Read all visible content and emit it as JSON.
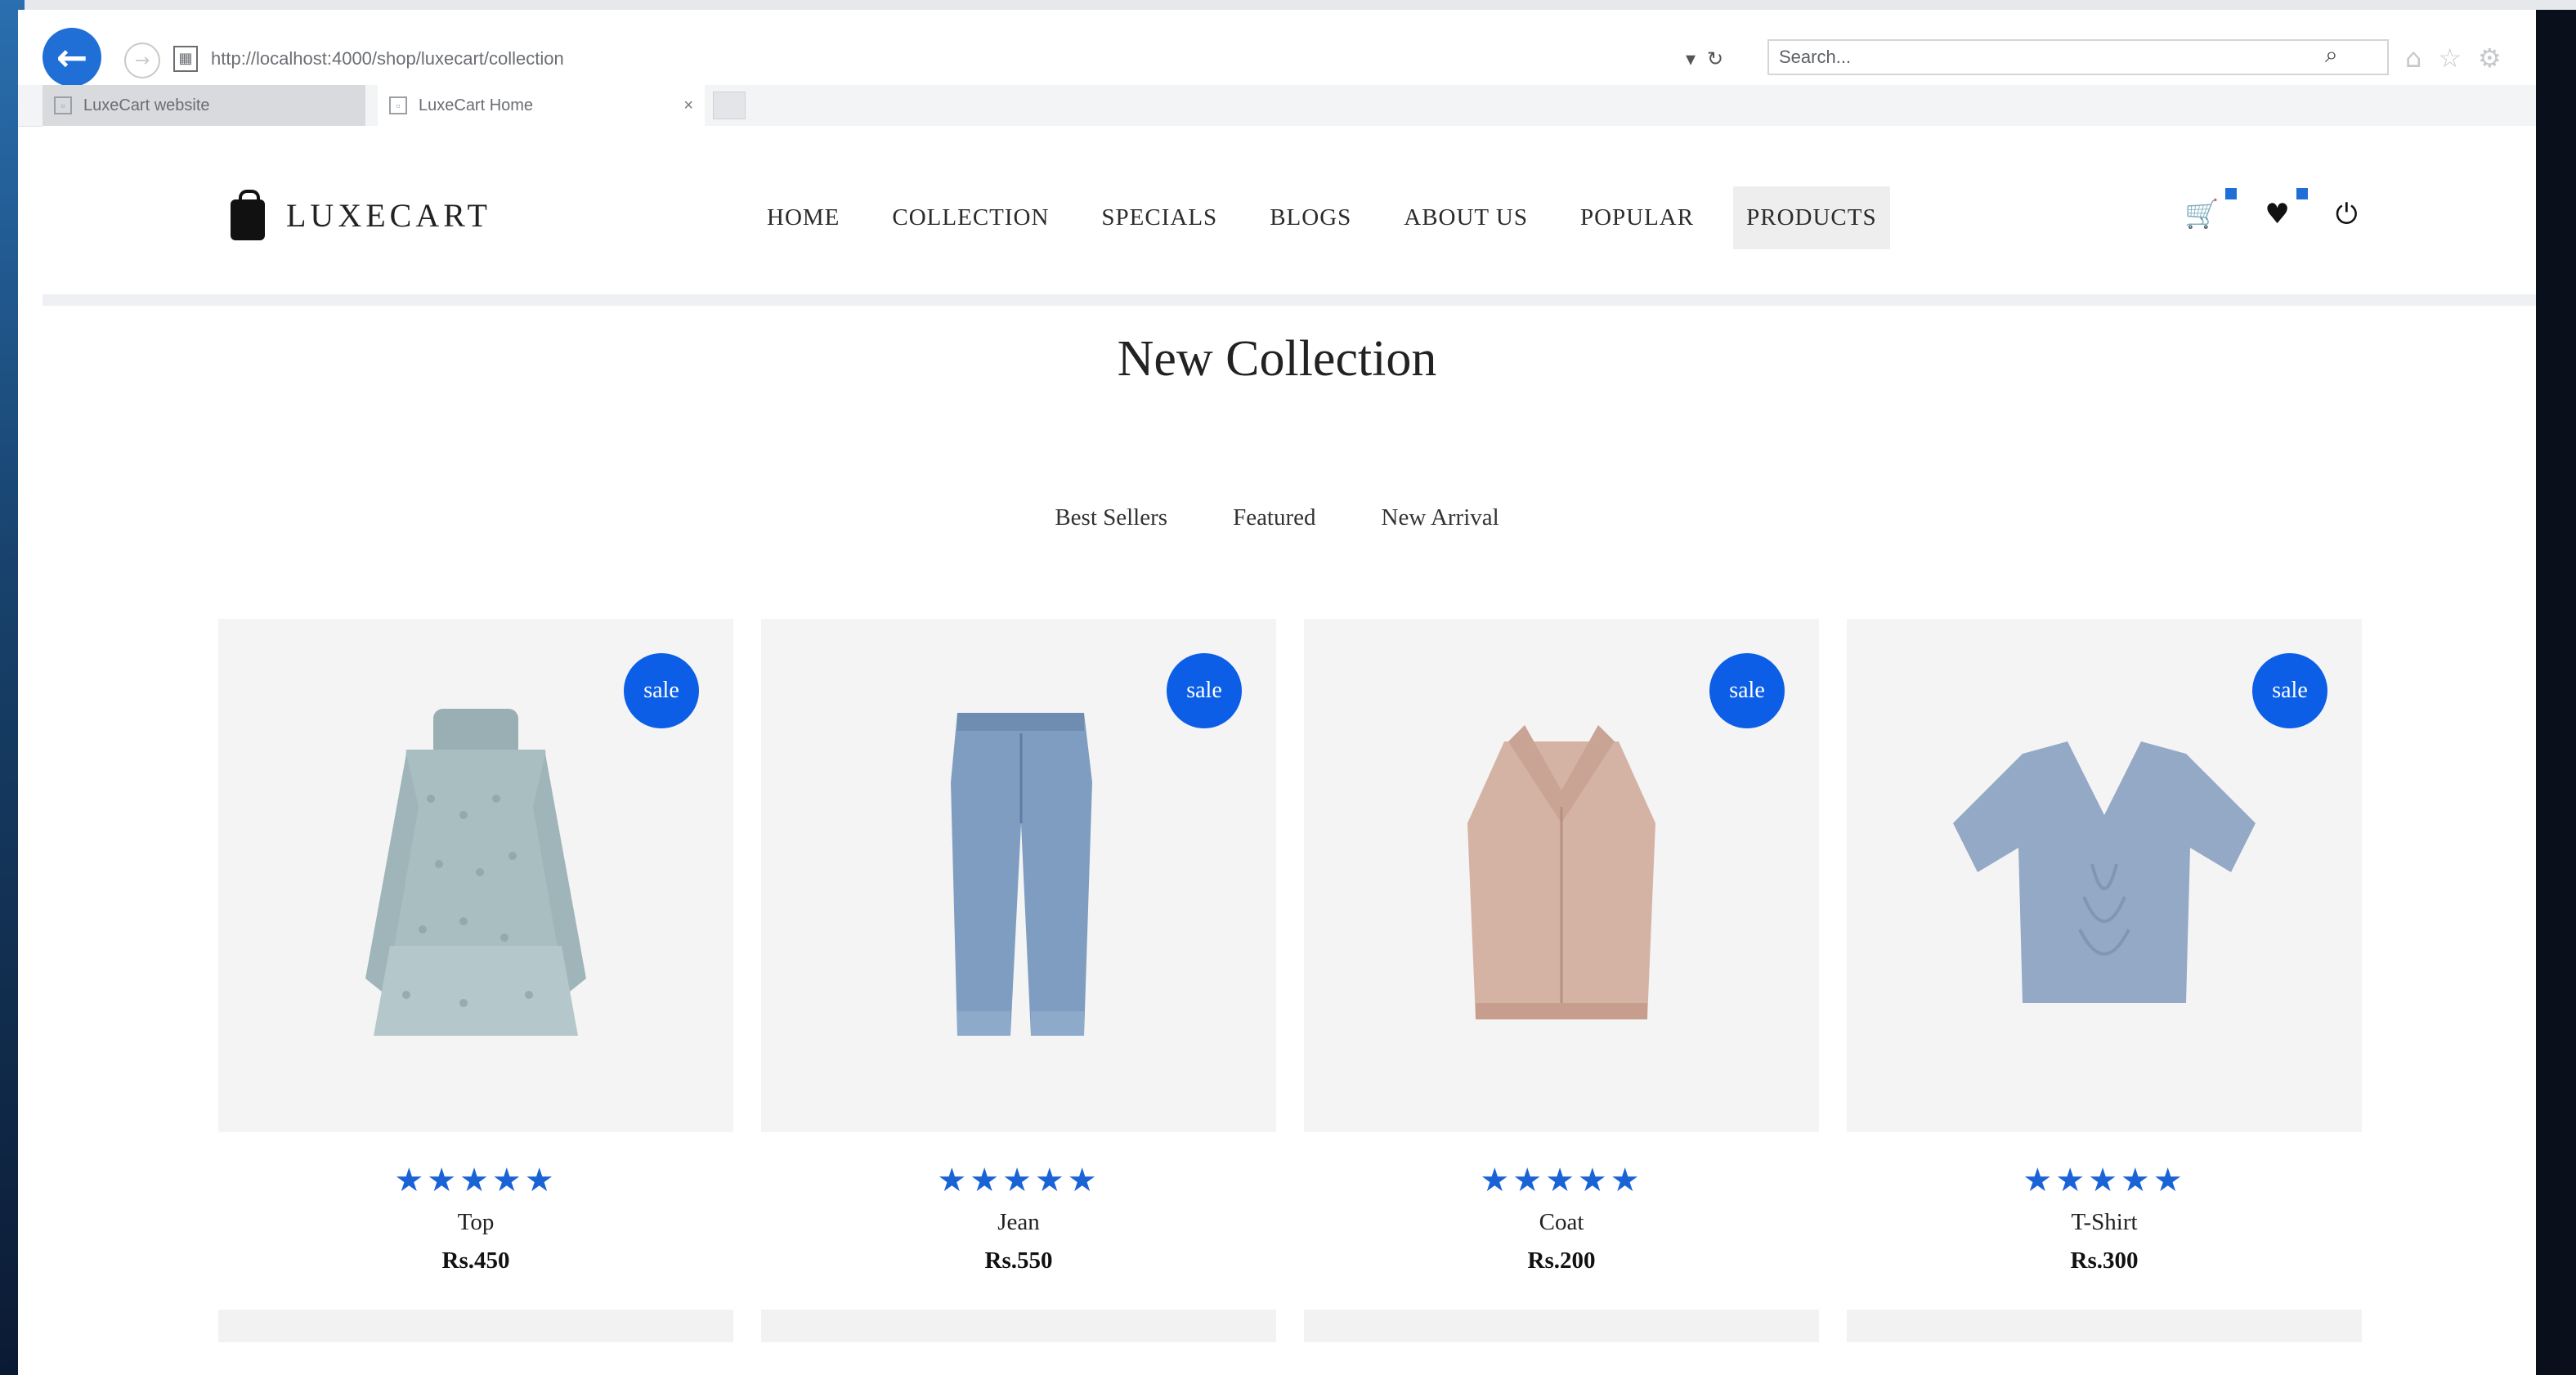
{
  "browser": {
    "url": "http://localhost:4000/shop/luxecart/collection",
    "search_placeholder": "Search...",
    "tabs": [
      {
        "label": "LuxeCart website"
      },
      {
        "label": "LuxeCart Home"
      }
    ]
  },
  "site": {
    "logo": "LUXECART",
    "nav": [
      "HOME",
      "COLLECTION",
      "SPECIALS",
      "BLOGS",
      "ABOUT US",
      "POPULAR",
      "PRODUCTS"
    ],
    "active_nav": "PRODUCTS",
    "icons": [
      "cart-icon",
      "heart-icon",
      "power-icon"
    ]
  },
  "main": {
    "title": "New Collection",
    "filters": [
      "Best Sellers",
      "Featured",
      "New Arrival"
    ],
    "products": [
      {
        "name": "Top",
        "price": "Rs.450",
        "badge": "sale",
        "rating": "★★★★★"
      },
      {
        "name": "Jean",
        "price": "Rs.550",
        "badge": "sale",
        "rating": "★★★★★"
      },
      {
        "name": "Coat",
        "price": "Rs.200",
        "badge": "sale",
        "rating": "★★★★★"
      },
      {
        "name": "T-Shirt",
        "price": "Rs.300",
        "badge": "sale",
        "rating": "★★★★★"
      }
    ]
  },
  "colors": {
    "accent": "#0c5ee6",
    "star": "#1a63d6",
    "card_bg": "#f4f4f4"
  }
}
